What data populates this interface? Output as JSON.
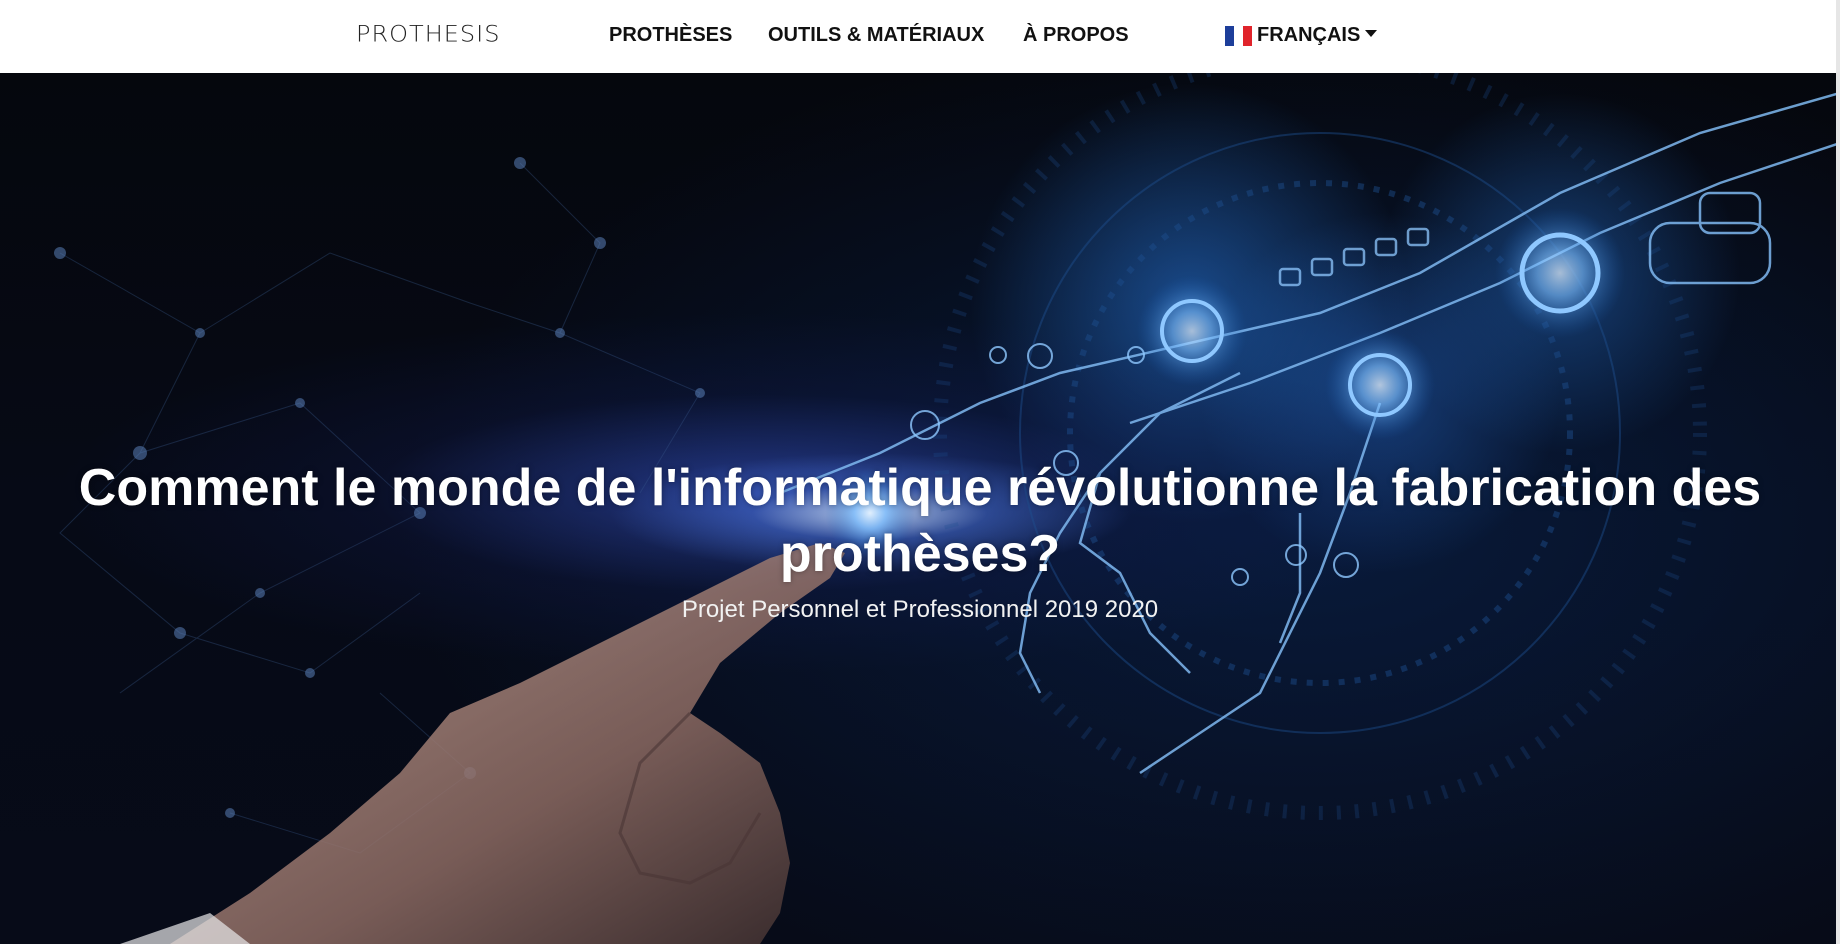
{
  "brand": {
    "logo_text": "PROTHESIS"
  },
  "nav": {
    "items": [
      {
        "label": "PROTHÈSES"
      },
      {
        "label": "OUTILS & MATÉRIAUX"
      },
      {
        "label": "À PROPOS"
      }
    ],
    "language": {
      "label": "FRANÇAIS",
      "flag_icon": "french-flag-icon",
      "flag_colors": [
        "#1d3e9a",
        "#ffffff",
        "#e0242b"
      ]
    }
  },
  "hero": {
    "title": "Comment le monde de l'informatique révolutionne la fabrication des prothèses?",
    "subtitle": "Projet Personnel et Professionnel 2019 2020",
    "background_icon": "robot-hand-touching-human-finger-image"
  },
  "colors": {
    "navbar_bg": "#ffffff",
    "nav_text": "#111111",
    "hero_text": "#ffffff",
    "hero_glow": "#3a8cff"
  }
}
